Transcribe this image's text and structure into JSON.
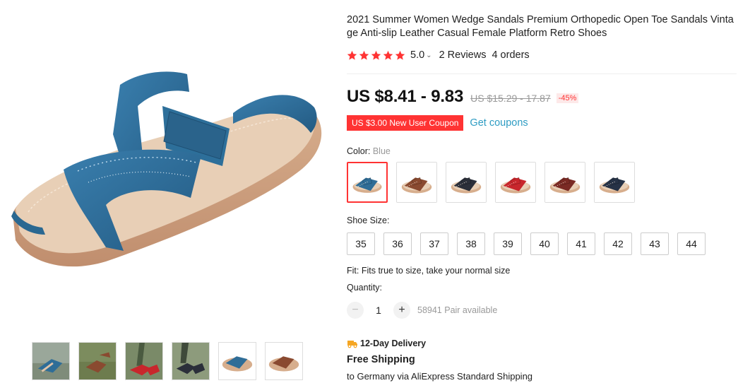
{
  "product": {
    "title": "2021 Summer Women Wedge Sandals Premium Orthopedic Open Toe Sandals Vintage Anti-slip Leather Casual Female Platform Retro Shoes",
    "main_image_icon": "blue-wedge-sandal-image"
  },
  "rating": {
    "stars": 5,
    "value": "5.0",
    "chevron": "⌄",
    "reviews": "2 Reviews",
    "orders": "4 orders",
    "star_color": "#f33"
  },
  "price": {
    "current": "US $8.41 - 9.83",
    "original": "US $15.29 - 17.87",
    "discount": "-45%"
  },
  "coupon": {
    "label": "US $3.00 New User Coupon",
    "link": "Get coupons",
    "color": "#f33",
    "link_color": "#2e9cc3"
  },
  "color": {
    "label": "Color:",
    "selected": "Blue",
    "options": [
      {
        "name": "blue",
        "hex": "#2f6d97",
        "selected": true
      },
      {
        "name": "brown",
        "hex": "#8a4a30",
        "selected": false
      },
      {
        "name": "black",
        "hex": "#2b2f3a",
        "selected": false
      },
      {
        "name": "red",
        "hex": "#c8262c",
        "selected": false
      },
      {
        "name": "wine",
        "hex": "#7a2a24",
        "selected": false
      },
      {
        "name": "navy",
        "hex": "#263246",
        "selected": false
      }
    ]
  },
  "size": {
    "label": "Shoe Size:",
    "options": [
      "35",
      "36",
      "37",
      "38",
      "39",
      "40",
      "41",
      "42",
      "43",
      "44"
    ]
  },
  "fit": "Fit: Fits true to size, take your normal size",
  "quantity": {
    "label": "Quantity:",
    "minus": "−",
    "value": "1",
    "plus": "+",
    "available": "58941 Pair available"
  },
  "delivery": {
    "icon": "truck-icon",
    "label": "12-Day Delivery",
    "shipping": "Free Shipping",
    "shipping_sub": "to Germany via AliExpress Standard Shipping"
  },
  "thumbnails": [
    {
      "name": "thumb-blue-worn",
      "hex": "#2f6d97"
    },
    {
      "name": "thumb-brown-worn",
      "hex": "#8a4a30"
    },
    {
      "name": "thumb-red-worn",
      "hex": "#c8262c"
    },
    {
      "name": "thumb-black-worn",
      "hex": "#2b2f3a"
    },
    {
      "name": "thumb-blue-product",
      "hex": "#2f6d97"
    },
    {
      "name": "thumb-brown-product",
      "hex": "#8a4a30"
    }
  ]
}
